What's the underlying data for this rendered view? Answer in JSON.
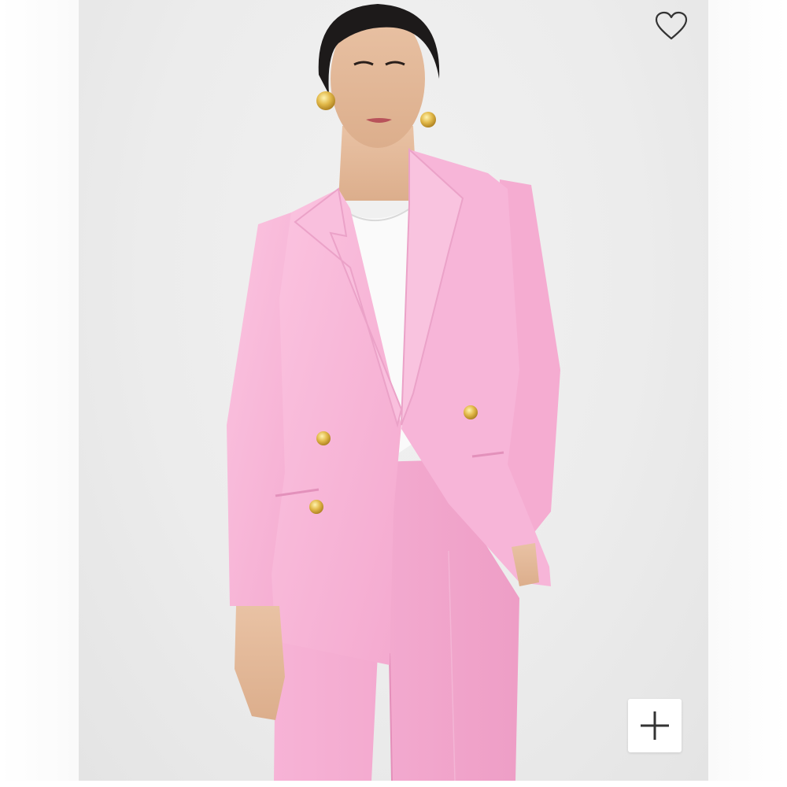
{
  "product_image": {
    "alt": "",
    "background_color": "#ececec",
    "garment_color": "#f8b8d8",
    "button_color": "#d9b24a"
  },
  "favorite": {
    "icon": "heart-outline-icon",
    "state": "not-favorited"
  },
  "zoom": {
    "icon": "plus-icon"
  },
  "colors": {
    "icon_stroke": "#333333",
    "control_bg": "#ffffff"
  }
}
